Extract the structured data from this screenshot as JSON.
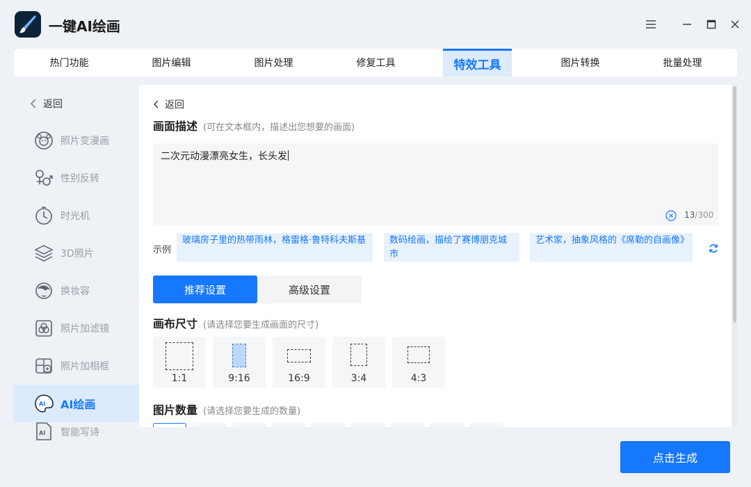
{
  "app": {
    "title": "一键AI绘画",
    "icons": {
      "logo": "brush-logo",
      "menu": "hamburger-icon",
      "minimize": "minimize-icon",
      "maximize": "maximize-icon",
      "close": "close-icon"
    }
  },
  "tabs": [
    {
      "label": "热门功能",
      "active": false
    },
    {
      "label": "图片编辑",
      "active": false
    },
    {
      "label": "图片处理",
      "active": false
    },
    {
      "label": "修复工具",
      "active": false
    },
    {
      "label": "特效工具",
      "active": true
    },
    {
      "label": "图片转换",
      "active": false
    },
    {
      "label": "批量处理",
      "active": false
    }
  ],
  "sidebar": {
    "back_label": "返回",
    "items": [
      {
        "label": "照片变漫画",
        "icon": "cartoon-face-icon"
      },
      {
        "label": "性别反转",
        "icon": "gender-icon"
      },
      {
        "label": "时光机",
        "icon": "clock-icon"
      },
      {
        "label": "3D照片",
        "icon": "layers-icon"
      },
      {
        "label": "换妆容",
        "icon": "makeup-icon"
      },
      {
        "label": "照片加滤镜",
        "icon": "filter-icon"
      },
      {
        "label": "照片加相框",
        "icon": "frame-icon"
      },
      {
        "label": "AI绘画",
        "icon": "ai-paint-icon",
        "active": true
      },
      {
        "label": "智能写诗",
        "icon": "ai-poem-icon"
      }
    ]
  },
  "main": {
    "back_label": "返回",
    "description": {
      "title": "画面描述",
      "hint": "(可在文本框内，描述出您想要的画面)",
      "value": "二次元动漫漂亮女生，长头发",
      "count": "13",
      "max": "/300"
    },
    "examples": {
      "label": "示例",
      "items": [
        "玻璃房子里的热带雨林，格雷格·鲁特科夫斯基",
        "数码绘画，描绘了赛博朋克城市",
        "艺术家，抽象风格的《席勒的自画像》"
      ]
    },
    "settings_tabs": {
      "recommended": "推荐设置",
      "advanced": "高级设置"
    },
    "canvas_size": {
      "title": "画布尺寸",
      "hint": "(请选择您要生成画面的尺寸)",
      "options": [
        {
          "label": "1:1",
          "selected": false
        },
        {
          "label": "9:16",
          "selected": true
        },
        {
          "label": "16:9",
          "selected": false
        },
        {
          "label": "3:4",
          "selected": false
        },
        {
          "label": "4:3",
          "selected": false
        }
      ]
    },
    "image_count": {
      "title": "图片数量",
      "hint": "(请选择您要生成的数量)"
    }
  },
  "generate_label": "点击生成",
  "colors": {
    "accent": "#1677ff",
    "accent_light": "#dcebfb",
    "example_bg": "#e8f2fd"
  }
}
